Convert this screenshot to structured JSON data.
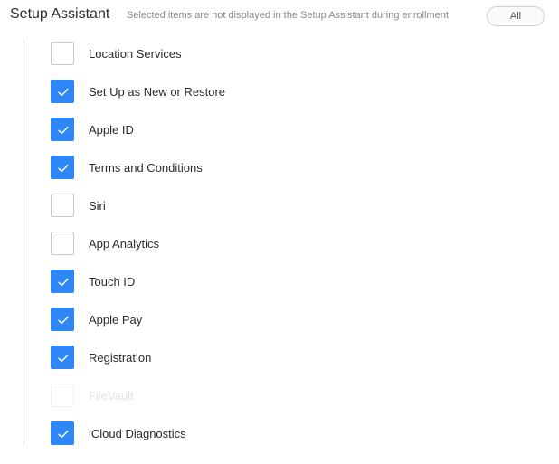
{
  "header": {
    "title": "Setup Assistant",
    "subtitle": "Selected items are not displayed in the Setup Assistant during enrollment",
    "all_button_label": "All"
  },
  "colors": {
    "accent": "#2f86f6",
    "text": "#2b2b2b",
    "muted": "#8a8a8a",
    "disabled": "#e3e3e3"
  },
  "items": [
    {
      "label": "Location Services",
      "checked": false,
      "disabled": false
    },
    {
      "label": "Set Up as New or Restore",
      "checked": true,
      "disabled": false
    },
    {
      "label": "Apple ID",
      "checked": true,
      "disabled": false
    },
    {
      "label": "Terms and Conditions",
      "checked": true,
      "disabled": false
    },
    {
      "label": "Siri",
      "checked": false,
      "disabled": false
    },
    {
      "label": "App Analytics",
      "checked": false,
      "disabled": false
    },
    {
      "label": "Touch ID",
      "checked": true,
      "disabled": false
    },
    {
      "label": "Apple Pay",
      "checked": true,
      "disabled": false
    },
    {
      "label": "Registration",
      "checked": true,
      "disabled": false
    },
    {
      "label": "FileVault",
      "checked": false,
      "disabled": true
    },
    {
      "label": "iCloud Diagnostics",
      "checked": true,
      "disabled": false
    }
  ]
}
